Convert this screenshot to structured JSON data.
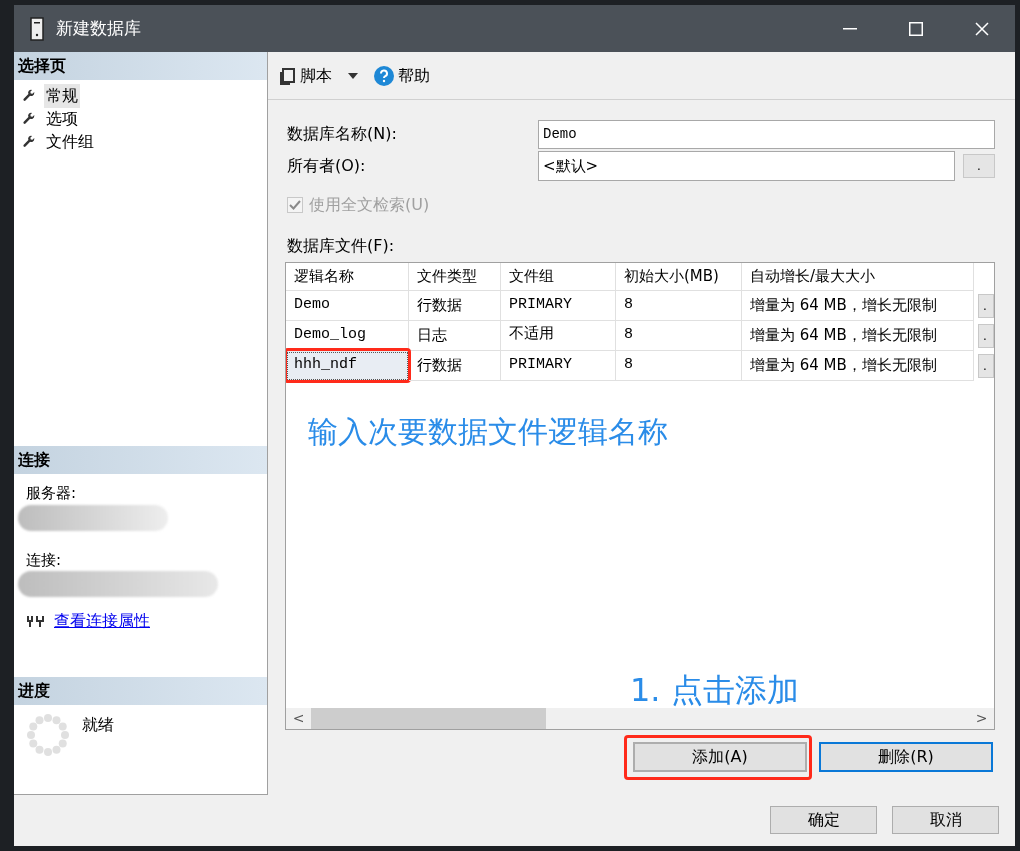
{
  "window": {
    "title": "新建数据库"
  },
  "sidebar": {
    "title": "选择页",
    "items": [
      {
        "label": "常规",
        "selected": true
      },
      {
        "label": "选项",
        "selected": false
      },
      {
        "label": "文件组",
        "selected": false
      }
    ]
  },
  "connection": {
    "title": "连接",
    "server_label": "服务器:",
    "connection_label": "连接:",
    "link": "查看连接属性"
  },
  "progress": {
    "title": "进度",
    "status": "就绪"
  },
  "toolbar": {
    "script": "脚本",
    "help": "帮助"
  },
  "form": {
    "name_label": "数据库名称(N):",
    "name_value": "Demo",
    "owner_label": "所有者(O):",
    "owner_value": "<默认>",
    "owner_button": ".",
    "fulltext": {
      "label": "使用全文检索(U)",
      "checked": true,
      "disabled": true
    }
  },
  "files": {
    "label": "数据库文件(F):",
    "columns": [
      "逻辑名称",
      "文件类型",
      "文件组",
      "初始大小(MB)",
      "自动增长/最大大小"
    ],
    "rows": [
      {
        "cells": [
          "Demo",
          "行数据",
          "PRIMARY",
          "8",
          "增量为 64 MB，增长无限制"
        ],
        "button": ".",
        "selected": false,
        "highlighted": false
      },
      {
        "cells": [
          "Demo_log",
          "日志",
          "不适用",
          "8",
          "增量为 64 MB，增长无限制"
        ],
        "button": ".",
        "selected": false,
        "highlighted": false
      },
      {
        "cells": [
          "hhh_ndf",
          "行数据",
          "PRIMARY",
          "8",
          "增量为 64 MB，增长无限制"
        ],
        "button": ".",
        "selected": true,
        "highlighted": true
      }
    ],
    "note": "输入次要数据文件逻辑名称",
    "scroll_left": "<",
    "scroll_right": ">"
  },
  "step_note": "1. 点击添加",
  "file_buttons": [
    {
      "label": "添加(A)",
      "highlighted": true,
      "focused": false
    },
    {
      "label": "删除(R)",
      "highlighted": false,
      "focused": true
    }
  ],
  "buttons": [
    "确定",
    "取消"
  ]
}
